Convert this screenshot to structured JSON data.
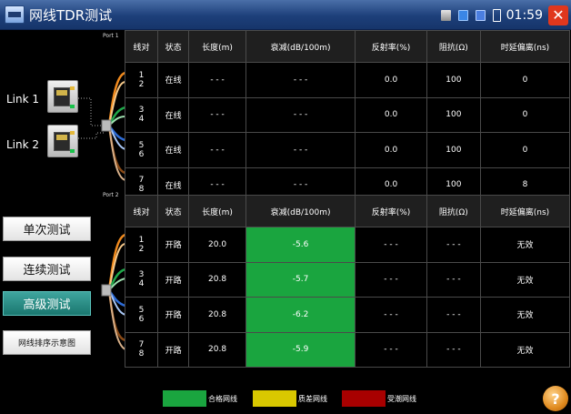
{
  "titlebar": {
    "title": "网线TDR测试",
    "time": "01:59",
    "close_glyph": "✕"
  },
  "left": {
    "link1_label": "Link 1",
    "link2_label": "Link 2",
    "buttons": {
      "single": "单次测试",
      "continuous": "连续测试",
      "advanced": "高级测试",
      "diagram": "网线排序示意图"
    }
  },
  "ports": {
    "port1_label": "Port 1",
    "port2_label": "Port 2"
  },
  "headers": {
    "pair": "线对",
    "status": "状态",
    "length": "长度(m)",
    "attenuation": "衰减(dB/100m)",
    "reflection": "反射率(%)",
    "impedance": "阻抗(Ω)",
    "delay": "时延偏离(ns)"
  },
  "port1_rows": [
    {
      "pair_top": "1",
      "pair_bottom": "2",
      "status": "在线",
      "length": "- - -",
      "attenuation": "- - -",
      "reflection": "0.0",
      "impedance": "100",
      "delay": "0"
    },
    {
      "pair_top": "3",
      "pair_bottom": "4",
      "status": "在线",
      "length": "- - -",
      "attenuation": "- - -",
      "reflection": "0.0",
      "impedance": "100",
      "delay": "0"
    },
    {
      "pair_top": "5",
      "pair_bottom": "6",
      "status": "在线",
      "length": "- - -",
      "attenuation": "- - -",
      "reflection": "0.0",
      "impedance": "100",
      "delay": "0"
    },
    {
      "pair_top": "7",
      "pair_bottom": "8",
      "status": "在线",
      "length": "- - -",
      "attenuation": "- - -",
      "reflection": "0.0",
      "impedance": "100",
      "delay": "8"
    }
  ],
  "port2_rows": [
    {
      "pair_top": "1",
      "pair_bottom": "2",
      "status": "开路",
      "length": "20.0",
      "attenuation": "-5.6",
      "reflection": "- - -",
      "impedance": "- - -",
      "delay": "无效"
    },
    {
      "pair_top": "3",
      "pair_bottom": "4",
      "status": "开路",
      "length": "20.8",
      "attenuation": "-5.7",
      "reflection": "- - -",
      "impedance": "- - -",
      "delay": "无效"
    },
    {
      "pair_top": "5",
      "pair_bottom": "6",
      "status": "开路",
      "length": "20.8",
      "attenuation": "-6.2",
      "reflection": "- - -",
      "impedance": "- - -",
      "delay": "无效"
    },
    {
      "pair_top": "7",
      "pair_bottom": "8",
      "status": "开路",
      "length": "20.8",
      "attenuation": "-5.9",
      "reflection": "- - -",
      "impedance": "- - -",
      "delay": "无效"
    }
  ],
  "legend": {
    "good": "合格网线",
    "poor": "质差网线",
    "damp": "受潮网线"
  },
  "colors": {
    "good": "#1aa53f",
    "poor": "#d9c800",
    "damp": "#a80000",
    "active_button": "#26857d"
  },
  "icons": {
    "help": "help-icon",
    "help_glyph": "?"
  }
}
